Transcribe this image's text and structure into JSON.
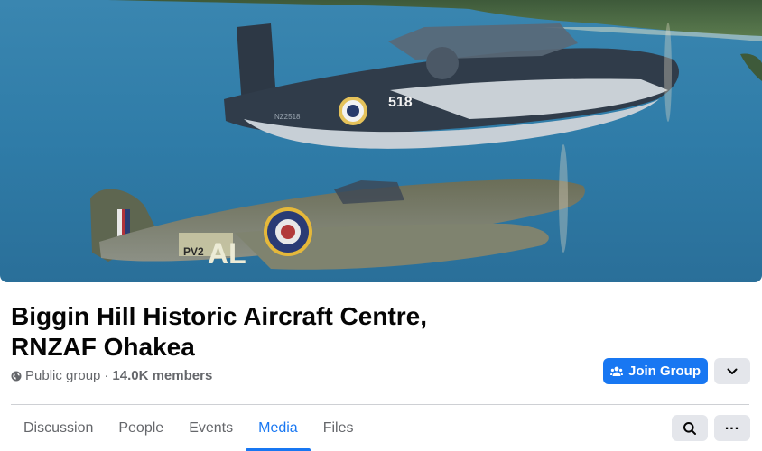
{
  "group": {
    "title": "Biggin Hill Historic Aircraft Centre, RNZAF Ohakea",
    "privacy": "Public group",
    "separator": "·",
    "members": "14.0K members"
  },
  "cover": {
    "aircraft_top_marking": "518",
    "aircraft_top_serial": "NZ2518",
    "aircraft_bottom_marking": "AL",
    "aircraft_bottom_code": "PV2"
  },
  "actions": {
    "join_label": "Join Group",
    "join_icon": "people-icon",
    "more_icon": "chevron-down-icon",
    "search_icon": "search-icon",
    "tabs_more_label": "..."
  },
  "tabs": [
    {
      "label": "Discussion",
      "active": false
    },
    {
      "label": "People",
      "active": false
    },
    {
      "label": "Events",
      "active": false
    },
    {
      "label": "Media",
      "active": true
    },
    {
      "label": "Files",
      "active": false
    }
  ],
  "colors": {
    "accent": "#1877f2",
    "secondary_button": "#e4e6eb",
    "muted_text": "#65676b"
  }
}
